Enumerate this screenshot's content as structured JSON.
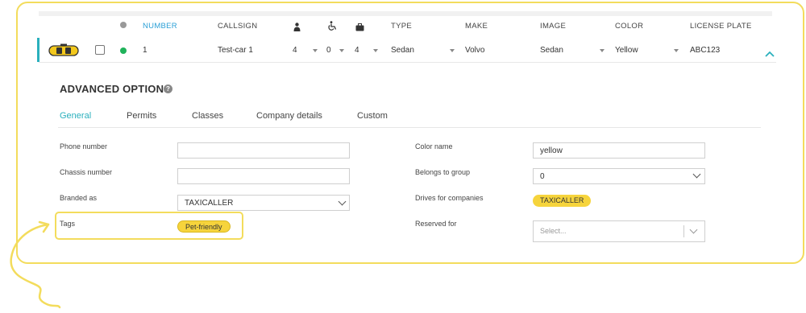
{
  "table": {
    "headers": {
      "number": "NUMBER",
      "callsign": "CALLSIGN",
      "type": "TYPE",
      "make": "MAKE",
      "image": "IMAGE",
      "color": "COLOR",
      "license_plate": "LICENSE PLATE"
    },
    "header_icons": [
      "status-dot-icon",
      "passenger-icon",
      "wheelchair-icon",
      "luggage-icon"
    ],
    "row": {
      "number": "1",
      "callsign": "Test-car 1",
      "passengers": "4",
      "wheelchairs": "0",
      "luggage": "4",
      "type": "Sedan",
      "make": "Volvo",
      "image": "Sedan",
      "color": "Yellow",
      "license_plate": "ABC123",
      "status_color": "#1fb25a"
    }
  },
  "advanced": {
    "title": "ADVANCED OPTIONS",
    "tabs": [
      "General",
      "Permits",
      "Classes",
      "Company details",
      "Custom"
    ],
    "active_tab": "General",
    "left": {
      "phone_label": "Phone number",
      "phone_value": "",
      "chassis_label": "Chassis number",
      "chassis_value": "",
      "branded_label": "Branded as",
      "branded_value": "TAXICALLER",
      "tags_label": "Tags",
      "tag_chip": "Pet-friendly"
    },
    "right": {
      "color_name_label": "Color name",
      "color_name_value": "yellow",
      "group_label": "Belongs to group",
      "group_value": "0",
      "drives_label": "Drives for companies",
      "drives_chip": "TAXICALLER",
      "reserved_label": "Reserved for",
      "reserved_placeholder": "Select..."
    }
  },
  "colors": {
    "accent": "#2ab0bd",
    "highlight": "#f3dc5c",
    "chip": "#f6d43c"
  }
}
